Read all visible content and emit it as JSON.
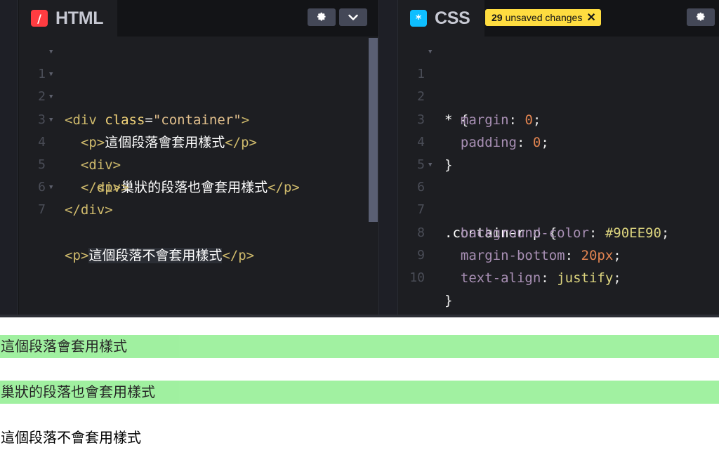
{
  "html_panel": {
    "title": "HTML",
    "badge_icon": "/",
    "badge_color": "#ff3c41",
    "settings_icon": "gear-icon",
    "collapse_icon": "chevron-down-icon"
  },
  "css_panel": {
    "title": "CSS",
    "badge_icon": "*",
    "badge_color": "#0ebeff",
    "unsaved_count": "29",
    "unsaved_text": "unsaved changes",
    "dismiss_icon": "close-icon",
    "settings_icon": "gear-icon"
  },
  "html_code": {
    "line_numbers": [
      "1",
      "2",
      "3",
      "4",
      "5",
      "6",
      "7"
    ],
    "l1_tag_open": "<div ",
    "l1_attr": "class",
    "l1_eq": "=",
    "l1_str": "\"container\"",
    "l1_tag_close": ">",
    "l2_open": "<p>",
    "l2_text": "這個段落會套用樣式",
    "l2_close": "</p>",
    "l3_open": "<div>",
    "l4_open": "<p>",
    "l4_text": "巢狀的段落也會套用樣式",
    "l4_close": "</p>",
    "l5_close": "</div>",
    "l6_close": "</div>",
    "l7_open": "<p>",
    "l7_text": "這個段落不會套用樣式",
    "l7_close": "</p>"
  },
  "css_code": {
    "line_numbers": [
      "1",
      "2",
      "3",
      "4",
      "5",
      "6",
      "7",
      "8",
      "9",
      "10"
    ],
    "l1_sel": "* ",
    "l1_brace": "{",
    "l2_prop": "margin",
    "l2_val": "0",
    "l3_prop": "padding",
    "l3_val": "0",
    "l4_brace": "}",
    "l6_sel": ".container p ",
    "l6_brace": "{",
    "l7_prop": "background-color",
    "l7_val": "#90EE90",
    "l8_prop": "margin-bottom",
    "l8_val": "20px",
    "l9_prop": "text-align",
    "l9_val": "justify",
    "l10_brace": "}",
    "colon": ":",
    "semicolon": ";"
  },
  "preview": {
    "p1": "這個段落會套用樣式",
    "p2": "巢狀的段落也會套用樣式",
    "p3": "這個段落不會套用樣式",
    "highlight_color": "#90EE90"
  }
}
